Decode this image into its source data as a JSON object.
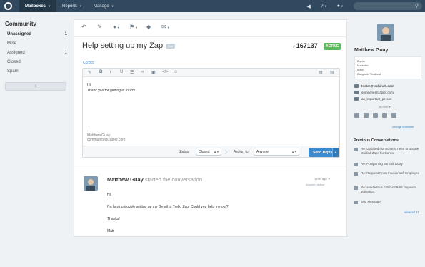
{
  "topbar": {
    "nav": [
      {
        "label": "Mailboxes",
        "active": true
      },
      {
        "label": "Reports",
        "active": false
      },
      {
        "label": "Manage",
        "active": false
      }
    ],
    "icons": [
      "megaphone-icon",
      "help-icon",
      "user-icon",
      "search-icon"
    ],
    "help_label": "?",
    "colors": {
      "bar": "#31495e",
      "active": "#243746"
    }
  },
  "sidebar": {
    "title": "Community",
    "items": [
      {
        "label": "Unassigned",
        "count": "1",
        "active": true
      },
      {
        "label": "Mine",
        "count": "",
        "active": false
      },
      {
        "label": "Assigned",
        "count": "1",
        "active": false
      },
      {
        "label": "Closed",
        "count": "",
        "active": false
      },
      {
        "label": "Spam",
        "count": "",
        "active": false
      }
    ],
    "add_label": "+"
  },
  "conversation": {
    "title": "Help setting up my Zap",
    "tag": "Zap",
    "number": "167137",
    "status": "ACTIVE",
    "cc_bcc": "Cc/Bcc",
    "reply": {
      "line1": "Hi,",
      "line2": "Thank you for getting in touch!",
      "sig_dash": "--",
      "sig_name": "Matthew Guay",
      "sig_email": "community@zapier.com"
    },
    "status_label": "Status:",
    "status_value": "Closed",
    "assign_label": "Assign to:",
    "assign_value": "Anyone",
    "send_label": "Send Reply",
    "thread": {
      "author": "Matthew Guay",
      "action": "started the conversation",
      "time": "1 min ago",
      "sub": "Anyone, Active",
      "body": [
        "Hi,",
        "I'm having trouble setting up my Gmail to Trello Zap. Could you help me out?",
        "Thanks!",
        "Matt"
      ]
    }
  },
  "customer": {
    "name": "Matthew Guay",
    "info": [
      "Zapier",
      "Marketer",
      "Male",
      "Bangkok, Thailand"
    ],
    "emails": [
      "tester@techinch.com",
      "someone@zapier.com",
      "an_important_person"
    ],
    "more": "8 more",
    "change": "change customer",
    "prev_title": "Previous Conversations",
    "prev": [
      "Re: Updated our Actions, need to update Guided Zaps for Convo",
      "Re: Postponing our call today",
      "Re: Request From Infusionsoft Employee",
      "Re: sendwithus d 2014-09-04 requests activation.",
      "Test Message"
    ],
    "view_all": "view all 11"
  }
}
